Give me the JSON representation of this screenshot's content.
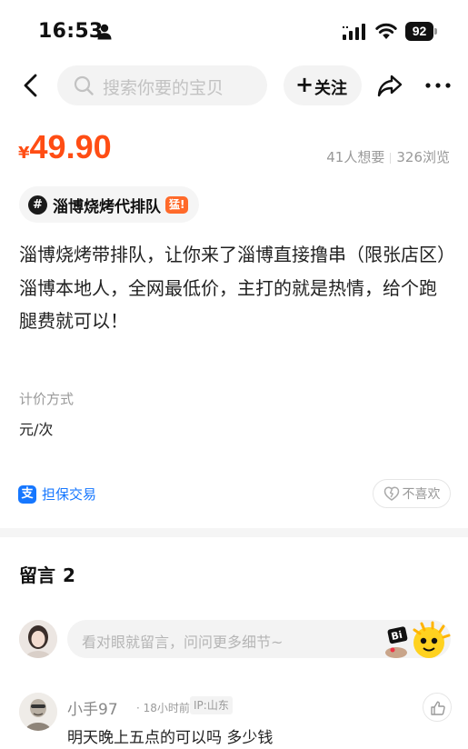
{
  "status_bar": {
    "time": "16:53",
    "battery": "92",
    "icons": [
      "person-icon",
      "signal-icon",
      "wifi-icon",
      "battery-icon"
    ]
  },
  "nav": {
    "back_icon": "chevron-left-icon",
    "search_placeholder": "搜索你要的宝贝",
    "follow_label": "关注",
    "share_icon": "share-icon",
    "more_icon": "more-dots-icon"
  },
  "product": {
    "currency": "¥",
    "price": "49.90",
    "want_count": "41人想要",
    "view_count": "326浏览",
    "topic": {
      "hash": "#",
      "label": "淄博烧烤代排队",
      "badge": "猛!"
    },
    "description": [
      "淄博烧烤带排队，让你来了淄博直接撸串（限张店区）",
      "淄博本地人，全网最低价，主打的就是热情，给个跑腿费就可以！"
    ],
    "pricing_label": "计价方式",
    "pricing_value": "元/次",
    "guarantee_icon": "支",
    "guarantee_label": "担保交易",
    "dislike_label": "不喜欢"
  },
  "comments": {
    "title": "留言",
    "count": "2",
    "input_placeholder": "看对眼就留言，问问更多细节~",
    "items": [
      {
        "name": "小手97",
        "time": "18小时前",
        "ip": "IP:山东",
        "text": "明天晚上五点的可以吗 多少钱"
      }
    ]
  },
  "colors": {
    "price": "#ff4d14",
    "link": "#1677ff",
    "badge": "#ff6a2a",
    "muted": "#999999"
  }
}
